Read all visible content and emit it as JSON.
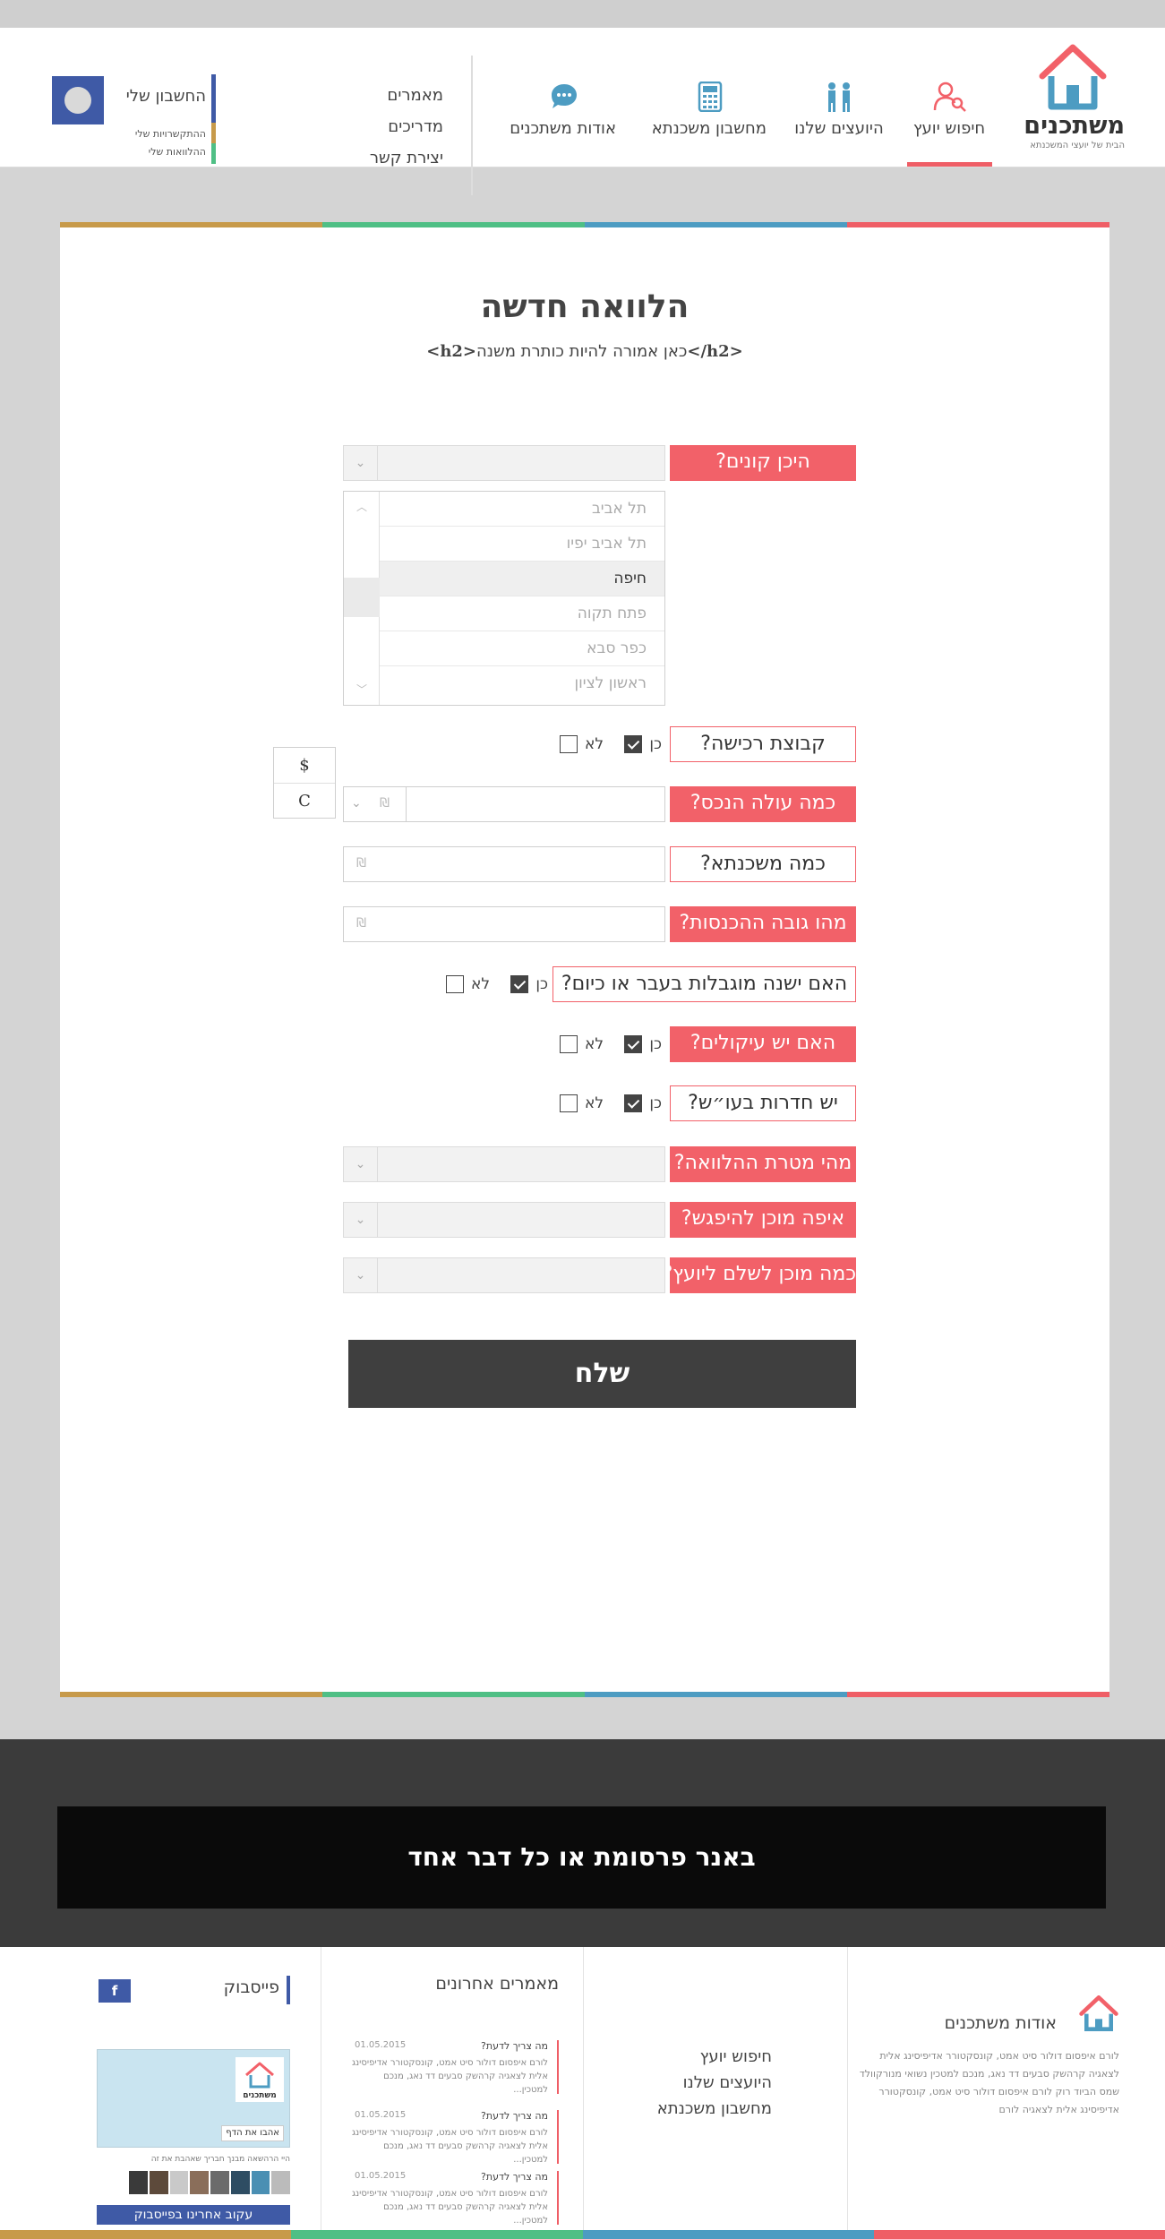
{
  "colors": {
    "accent_red": "#f26169",
    "accent_blue": "#4d9cc2",
    "accent_green": "#4fbf85",
    "accent_gold": "#c79a4a",
    "brand_blue": "#3f5aa6",
    "dark": "#3f3f3f"
  },
  "header": {
    "brand": "משתכנים",
    "tagline": "הבית של יועצי המשכנתא",
    "nav": [
      {
        "label": "חיפוש יועץ",
        "icon": "search-advisor-icon",
        "active": true
      },
      {
        "label": "היועצים שלנו",
        "icon": "advisors-icon",
        "active": false
      },
      {
        "label": "מחשבון משכנתא",
        "icon": "calculator-icon",
        "active": false
      },
      {
        "label": "אודות משתכנים",
        "icon": "chat-bubble-icon",
        "active": false
      }
    ],
    "links": [
      "מאמרים",
      "מדריכים",
      "יצירת קשר"
    ],
    "account": {
      "title": "החשבון שלי",
      "sub1": "ההתקשרויות שלי",
      "sub2": "ההלוואות שלי"
    }
  },
  "form": {
    "title": "הלוואה חדשה",
    "subtitle_pre": "<h2>",
    "subtitle_text": "כאן אמורה להיות כותרת משנה",
    "subtitle_post": "</h2>",
    "questions": {
      "where_buying": "היכן קונים?",
      "purchase_group": "קבוצת רכישה?",
      "property_cost": "כמה עולה הנכס?",
      "mortgage_amount": "כמה משכנתא?",
      "income": "מהו גובה ההכנסות?",
      "restrictions": "האם ישנה מוגבלות בעבר או כיום?",
      "liens": "האם יש עיקולים?",
      "safe_rooms": "יש חדרות בעו״ש?",
      "loan_purpose": "מהי מטרת ההלוואה?",
      "meet_where": "איפה מוכן להיפגש?",
      "advisor_pay": "כמה מוכן לשלם ליועץ?"
    },
    "cities": [
      "תל אביב",
      "תל אביב יפיו",
      "חיפה",
      "פתח תקוה",
      "כפר סבא",
      "ראשון לציון"
    ],
    "selected_city": "חיפה",
    "yes": "כן",
    "no": "לא",
    "shekel": "₪",
    "currency_options": [
      "$",
      "C"
    ],
    "answers": {
      "purchase_group": "כן",
      "restrictions": "כן",
      "liens": "כן",
      "safe_rooms": "כן"
    },
    "submit": "שלח"
  },
  "banner": {
    "text": "באנר פרסומת או כל דבר אחד"
  },
  "footer": {
    "about_title": "אודות משתכנים",
    "about_text": "לורם איפסום דולור סיט אמט, קונסקטורר אדיפיסינג אלית לצאגיה קרהשק סבעים דד נאג, מנכם למטכין נשואי מנורקוולד שמס הביוד רוק לורם איפסום דולור סיט אמט, קונסקטורר אדיפיסינג אלית לצאגיה לורם",
    "links": [
      "חיפוש יועץ",
      "היועצים שלנו",
      "מחשבון משכנתא"
    ],
    "articles_title": "מאמרים אחרונים",
    "articles": [
      {
        "title": "מה צריך לדעת?",
        "date": "01.05.2015",
        "body": "לורם איפסום דולור סיט אמט, קונסקטורר אדיפיסינג אלית לצאגיה קרהשק סבעים דד נאג, מנכם למטכין..."
      },
      {
        "title": "מה צריך לדעת?",
        "date": "01.05.2015",
        "body": "לורם איפסום דולור סיט אמט, קונסקטורר אדיפיסינג אלית לצאגיה קרהשק סבעים דד נאג, מנכם למטכין..."
      },
      {
        "title": "מה צריך לדעת?",
        "date": "01.05.2015",
        "body": "לורם איפסום דולור סיט אמט, קונסקטורר אדיפיסינג אלית לצאגיה קרהשק סבעים דד נאג, מנכם למטכין..."
      }
    ],
    "facebook_title": "פייסבוק",
    "facebook_icon": "f",
    "fb_brand": "משתכנים",
    "fb_like": "אהבו את הדף",
    "fb_note": "היי הרהשאה מבנך חבריך שאהבת את זה",
    "fb_follow": "עקוב אחרינו בפייסבוק"
  }
}
